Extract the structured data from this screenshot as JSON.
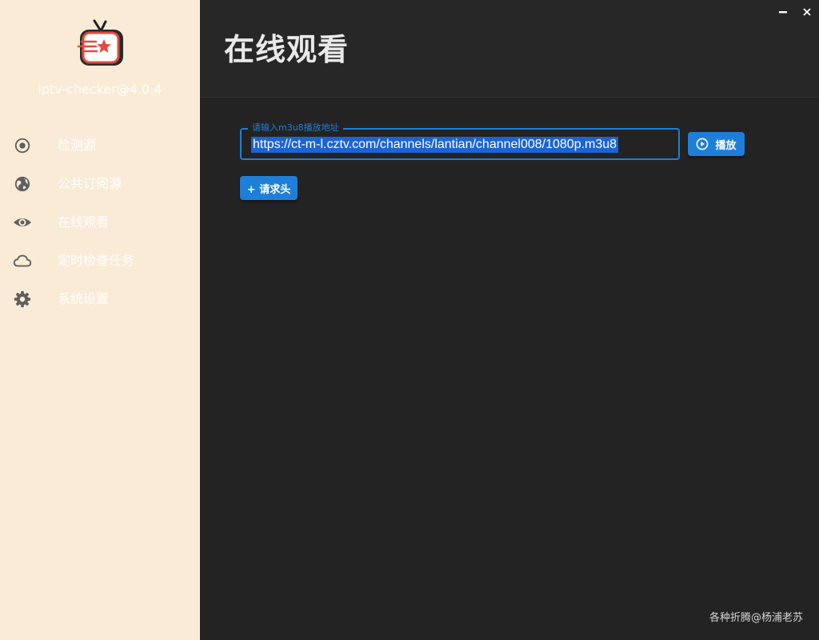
{
  "sidebar": {
    "app_version": "iptv-checker@4.0.4",
    "items": [
      {
        "label": "检测源",
        "icon": "radio-target-icon"
      },
      {
        "label": "公共订阅源",
        "icon": "globe-icon"
      },
      {
        "label": "在线观看",
        "icon": "eye-icon"
      },
      {
        "label": "定时检查任务",
        "icon": "cloud-icon"
      },
      {
        "label": "系统设置",
        "icon": "gear-icon"
      }
    ]
  },
  "header": {
    "title": "在线观看"
  },
  "player": {
    "url_label": "请输入m3u8播放地址",
    "url_value": "https://ct-m-l.cztv.com/channels/lantian/channel008/1080p.m3u8",
    "play_label": "播放",
    "add_header_label": "+ 请求头"
  },
  "footer": {
    "credit": "各种折腾@杨浦老苏"
  },
  "colors": {
    "accent": "#1e7fd8",
    "sidebar_bg": "#faebd7",
    "main_bg": "#232323"
  }
}
